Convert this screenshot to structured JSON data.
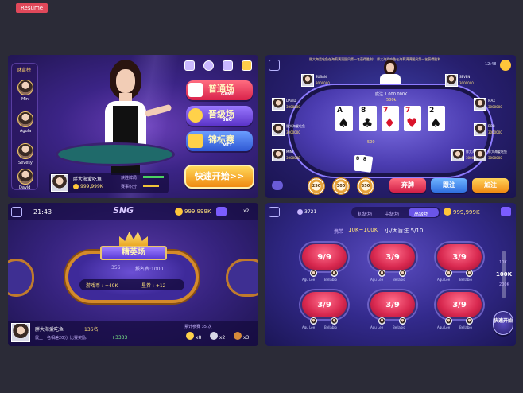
{
  "header": {
    "resume_label": "Resume"
  },
  "lobby": {
    "rich_list_label": "财富榜",
    "rich_players": [
      "Mini",
      "Agula",
      "Sevesy",
      "David"
    ],
    "mode_buttons": [
      {
        "title": "普通场",
        "sub": "GAME"
      },
      {
        "title": "晋级场",
        "sub": "SNG"
      },
      {
        "title": "锦标赛",
        "sub": "MTT"
      }
    ],
    "quick_start": "快速开始>>",
    "player_name": "胖大海爱吃鱼",
    "player_coins": "999,999K",
    "stat_win_label": "获胜牌局",
    "stat_match_label": "赛事积分",
    "colors": {
      "game": "#e8334f",
      "sng": "#6a45d6",
      "mtt": "#3f6fe0",
      "quick": "#f3a51c"
    }
  },
  "table": {
    "marquee": "胖大海爱吃鱼在海莉满满国风第一名获得胜利！ 胖大海爱吃鱼在海莉满满国风第一名获得胜利",
    "time": "12:48",
    "pot_label": "底注 1 000 000K",
    "pot_small": "500k",
    "center_bet": "500",
    "seats": [
      {
        "name": "SUSAN",
        "chips": "3000000"
      },
      {
        "name": "SEVEN",
        "chips": "3000000"
      },
      {
        "name": "DAVID",
        "chips": "3000000"
      },
      {
        "name": "MAX",
        "chips": "3000000"
      },
      {
        "name": "胖大海爱吃鱼",
        "chips": "3000000"
      },
      {
        "name": "BOB",
        "chips": "3000000"
      },
      {
        "name": "MINI",
        "chips": "3000000"
      },
      {
        "name": "胖大海爱吃鱼",
        "chips": "3000000"
      },
      {
        "name": "胖大海爱吃鱼",
        "chips": "3000000"
      }
    ],
    "community_cards": [
      {
        "rank": "A",
        "suit": "♠",
        "red": false
      },
      {
        "rank": "8",
        "suit": "♣",
        "red": false
      },
      {
        "rank": "7",
        "suit": "♦",
        "red": true
      },
      {
        "rank": "7",
        "suit": "♥",
        "red": true
      },
      {
        "rank": "2",
        "suit": "♠",
        "red": false
      }
    ],
    "hand_cards": [
      "8",
      "8"
    ],
    "raise_chips": [
      "250",
      "300",
      "350"
    ],
    "actions": {
      "fold": "弃牌",
      "call": "跟注",
      "raise": "加注"
    }
  },
  "sng": {
    "time": "21:43",
    "title": "SNG",
    "coins": "999,999K",
    "multiplier": "x2",
    "banner": "精英场",
    "entrants": "356",
    "fee": "报名费:1000",
    "reward_coins": "游戏币 : +40K",
    "reward_stars": "星券 : +12",
    "player_name": "胖大海爱吃鱼",
    "player_coins": "136名",
    "player_desc": "鼠上一名相差20分",
    "player_desc2": "比赛奖励:",
    "player_bonus": "+3333",
    "total_label": "累计参赛 35 次",
    "medals": [
      "x8",
      "x2",
      "x3"
    ]
  },
  "rooms": {
    "online": "3721",
    "tabs": [
      "初级场",
      "中级场",
      "高级场"
    ],
    "active_tab": 2,
    "coins": "999,999K",
    "blind_label": "携带",
    "blind_range": "10K~100K",
    "small_blind": "小/大盲注 5/10",
    "tables": [
      {
        "seats": "9/9",
        "p1": "Agu Lee",
        "p2": "Bellabio"
      },
      {
        "seats": "3/9",
        "p1": "Agu Lee",
        "p2": "Bellabio"
      },
      {
        "seats": "3/9",
        "p1": "Agu Lee",
        "p2": "Bellabio"
      },
      {
        "seats": "3/9",
        "p1": "Agu Lee",
        "p2": "Bellabio"
      },
      {
        "seats": "3/9",
        "p1": "Agu Lee",
        "p2": "Bellabio"
      },
      {
        "seats": "3/9",
        "p1": "Agu Lee",
        "p2": "Bellabio"
      }
    ],
    "stakes": [
      "10K",
      "100K",
      "200K"
    ],
    "active_stake": 1,
    "quick": "快速开始"
  }
}
